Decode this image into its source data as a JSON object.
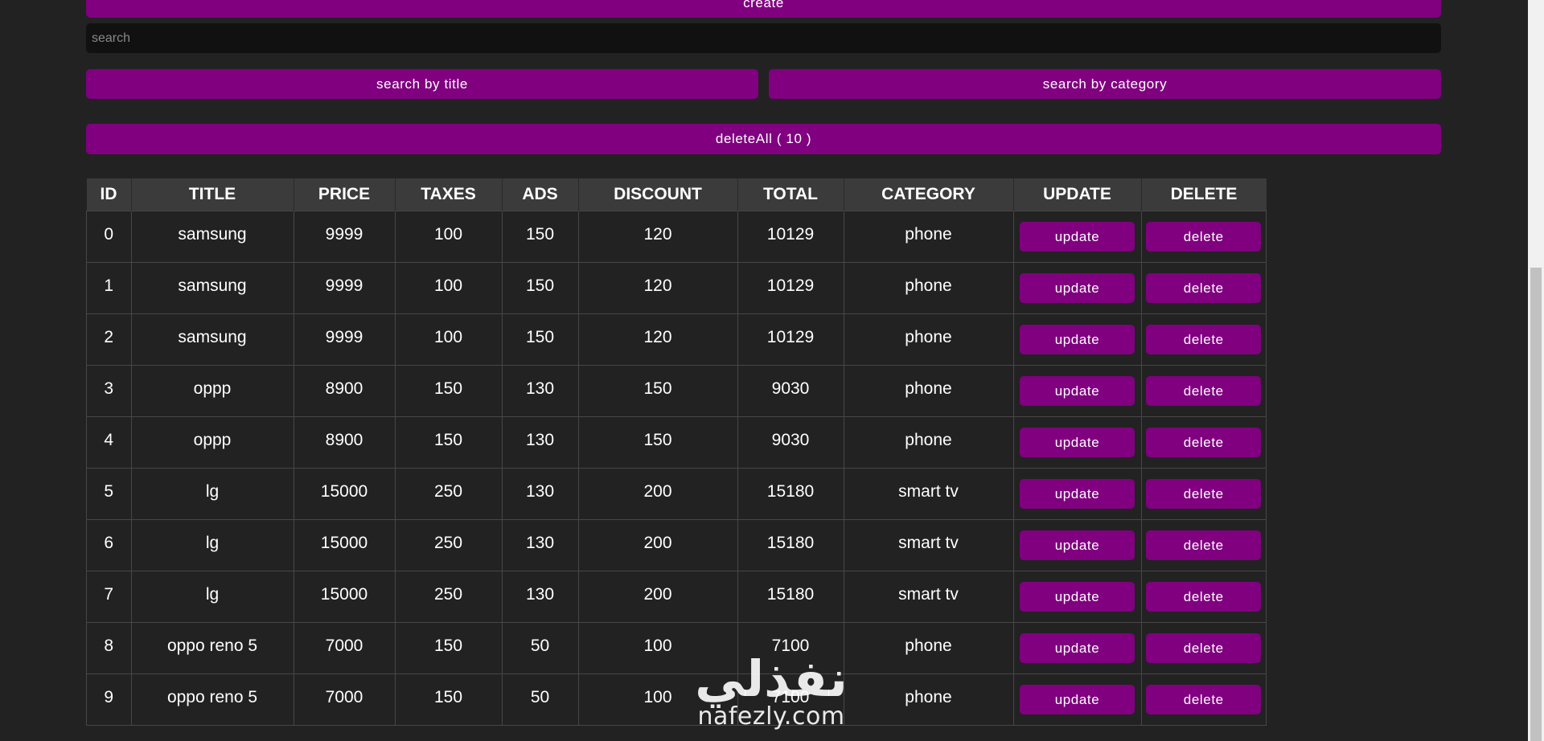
{
  "toolbar": {
    "create_label": "create",
    "search_placeholder": "search",
    "search_value": "",
    "search_by_title_label": "search by title",
    "search_by_category_label": "search by category",
    "delete_all_label": "deleteAll ( 10 )"
  },
  "table": {
    "headers": [
      "ID",
      "TITLE",
      "PRICE",
      "TAXES",
      "ADS",
      "DISCOUNT",
      "TOTAL",
      "CATEGORY",
      "UPDATE",
      "DELETE"
    ],
    "update_label": "update",
    "delete_label": "delete",
    "rows": [
      {
        "id": "0",
        "title": "samsung",
        "price": "9999",
        "taxes": "100",
        "ads": "150",
        "discount": "120",
        "total": "10129",
        "category": "phone"
      },
      {
        "id": "1",
        "title": "samsung",
        "price": "9999",
        "taxes": "100",
        "ads": "150",
        "discount": "120",
        "total": "10129",
        "category": "phone"
      },
      {
        "id": "2",
        "title": "samsung",
        "price": "9999",
        "taxes": "100",
        "ads": "150",
        "discount": "120",
        "total": "10129",
        "category": "phone"
      },
      {
        "id": "3",
        "title": "oppp",
        "price": "8900",
        "taxes": "150",
        "ads": "130",
        "discount": "150",
        "total": "9030",
        "category": "phone"
      },
      {
        "id": "4",
        "title": "oppp",
        "price": "8900",
        "taxes": "150",
        "ads": "130",
        "discount": "150",
        "total": "9030",
        "category": "phone"
      },
      {
        "id": "5",
        "title": "lg",
        "price": "15000",
        "taxes": "250",
        "ads": "130",
        "discount": "200",
        "total": "15180",
        "category": "smart tv"
      },
      {
        "id": "6",
        "title": "lg",
        "price": "15000",
        "taxes": "250",
        "ads": "130",
        "discount": "200",
        "total": "15180",
        "category": "smart tv"
      },
      {
        "id": "7",
        "title": "lg",
        "price": "15000",
        "taxes": "250",
        "ads": "130",
        "discount": "200",
        "total": "15180",
        "category": "smart tv"
      },
      {
        "id": "8",
        "title": "oppo reno 5",
        "price": "7000",
        "taxes": "150",
        "ads": "50",
        "discount": "100",
        "total": "7100",
        "category": "phone"
      },
      {
        "id": "9",
        "title": "oppo reno 5",
        "price": "7000",
        "taxes": "150",
        "ads": "50",
        "discount": "100",
        "total": "7100",
        "category": "phone"
      }
    ]
  },
  "watermark": {
    "arabic": "نفذلي",
    "latin": "nafezly.com"
  },
  "colors": {
    "accent": "#800080",
    "background": "#222222",
    "input_background": "#111111",
    "header_background": "#3b3b3b"
  }
}
